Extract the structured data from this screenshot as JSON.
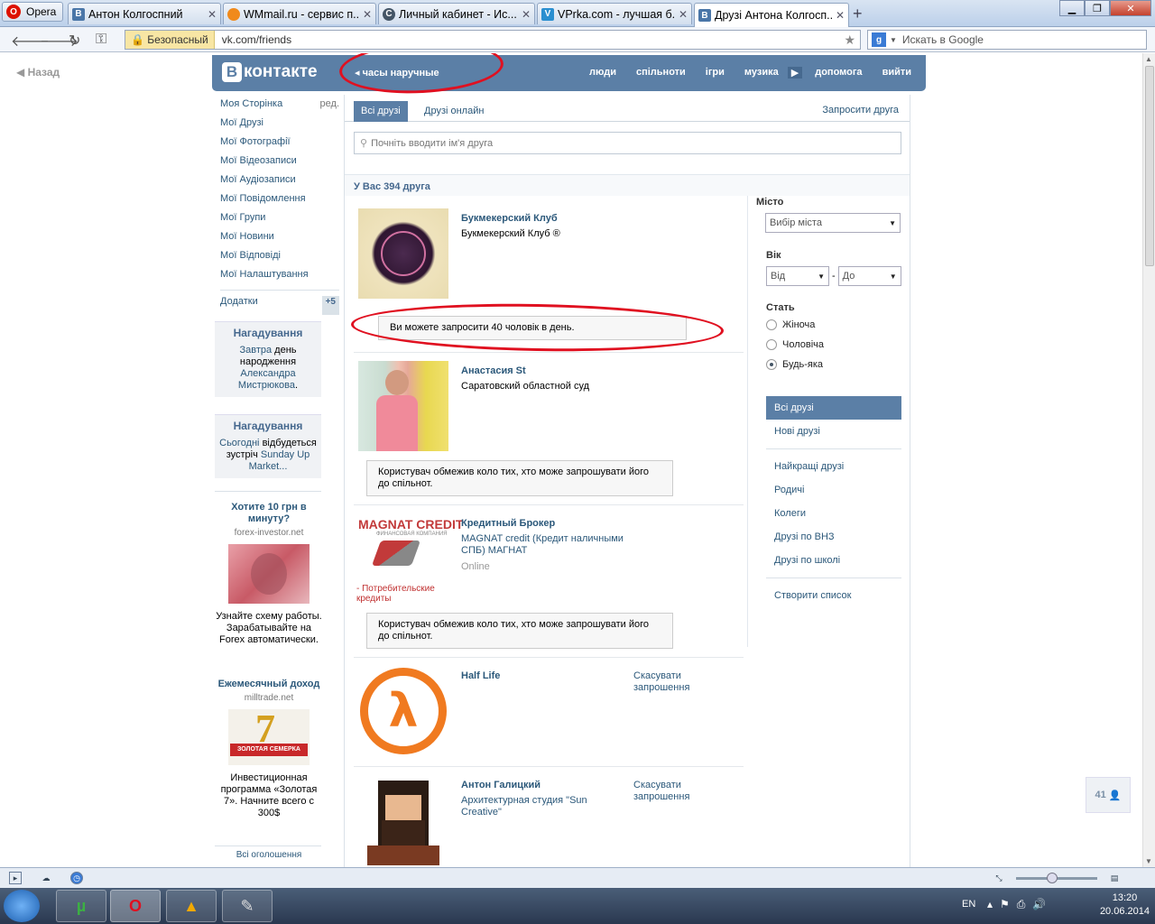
{
  "browser": {
    "opera_label": "Opera",
    "tabs": [
      {
        "title": "Антон Колгоспний",
        "favicon": "vk-icon",
        "color": "#4a76a8"
      },
      {
        "title": "WMmail.ru - сервис п...",
        "favicon": "wmmail-icon",
        "color": "#f08a1c"
      },
      {
        "title": "Личный кабинет - Ис...",
        "favicon": "cabinet-icon",
        "color": "#445566"
      },
      {
        "title": "VPrka.com - лучшая б...",
        "favicon": "vprka-icon",
        "color": "#2a8fd0"
      },
      {
        "title": "Друзі Антона Колгосп...",
        "favicon": "vk-icon",
        "color": "#4a76a8"
      }
    ],
    "security_label": "Безопасный",
    "url": "vk.com/friends",
    "search_placeholder": "Искать в Google"
  },
  "page": {
    "back_label": "Назад",
    "logo_text": "контакте",
    "logo_letter": "В",
    "current_search": "часы наручные",
    "nav": [
      "люди",
      "спільноти",
      "ігри",
      "музика",
      "допомога",
      "вийти"
    ],
    "left_menu": [
      {
        "label": "Моя Сторінка",
        "extra": "ред."
      },
      {
        "label": "Мої Друзі"
      },
      {
        "label": "Мої Фотографії"
      },
      {
        "label": "Мої Відеозаписи"
      },
      {
        "label": "Мої Аудіозаписи"
      },
      {
        "label": "Мої Повідомлення"
      },
      {
        "label": "Мої Групи"
      },
      {
        "label": "Мої Новини"
      },
      {
        "label": "Мої Відповіді"
      },
      {
        "label": "Мої Налаштування"
      }
    ],
    "apps_label": "Додатки",
    "apps_badge": "+5",
    "reminders": [
      {
        "title": "Нагадування",
        "link1": "Завтра",
        "text1": " день народження ",
        "link2": "Александра Мистрюкова",
        "text2": "."
      },
      {
        "title": "Нагадування",
        "link1": "Сьогодні",
        "text1": " відбудеться зустріч ",
        "link2": "Sunday Up Market...",
        "text2": ""
      }
    ],
    "ads": [
      {
        "title": "Хотите 10 грн в минуту?",
        "source": "forex-investor.net",
        "text": "Узнайте схему работы. Зарабатывайте на Forex автоматически."
      },
      {
        "title": "Ежемесячный доход",
        "source": "milltrade.net",
        "image_caption": "ЗОЛОТАЯ СЕМЕРКА",
        "text": "Инвестиционная программа «Золотая 7». Начните всего с 300$"
      }
    ],
    "all_ads_label": "Всі оголошення"
  },
  "friends": {
    "tabs": [
      "Всі друзі",
      "Друзі онлайн"
    ],
    "invite_label": "Запросити друга",
    "search_placeholder": "Почніть вводити ім'я друга",
    "count_label": "У Вас 394 друга",
    "items": [
      {
        "name": "Букмекерский Клуб",
        "status": "Букмекерский Клуб ®",
        "note": "Ви можете запросити 40 чоловік в день."
      },
      {
        "name": "Анастасия St",
        "status": "Саратовский областной суд",
        "note": "Користувач обмежив коло тих, хто може запрошувати його до спільнот."
      },
      {
        "name": "Кредитный Брокер",
        "status": "MAGNAT credit (Кредит наличными СПБ) МАГНАТ",
        "extra": "Online",
        "logo_text": "MAGNAT CREDIT",
        "logo_sub": "ФИНАНСОВАЯ КОМПАНИЯ",
        "logo_caption": "- Потребительские кредиты",
        "note": "Користувач обмежив коло тих, хто може запрошувати його до спільнот."
      },
      {
        "name": "Half Life",
        "status": "",
        "cancel": "Скасувати запрошення"
      },
      {
        "name": "Антон Галицкий",
        "status": "Архитектурная студия \"Sun Creative\"",
        "cancel": "Скасувати запрошення"
      }
    ]
  },
  "filters": {
    "city_label": "Місто",
    "city_value": "Вибір міста",
    "age_label": "Вік",
    "age_from": "Від",
    "age_to": "До",
    "age_dash": "-",
    "sex_label": "Стать",
    "sex_options": [
      "Жіноча",
      "Чоловіча",
      "Будь-яка"
    ],
    "sex_selected": "Будь-яка",
    "menu": [
      "Всі друзі",
      "Нові друзі",
      "Найкращі друзі",
      "Родичі",
      "Колеги",
      "Друзі по ВНЗ",
      "Друзі по школі",
      "Створити список"
    ]
  },
  "online_count": "41",
  "system": {
    "lang": "EN",
    "time": "13:20",
    "date": "20.06.2014"
  }
}
